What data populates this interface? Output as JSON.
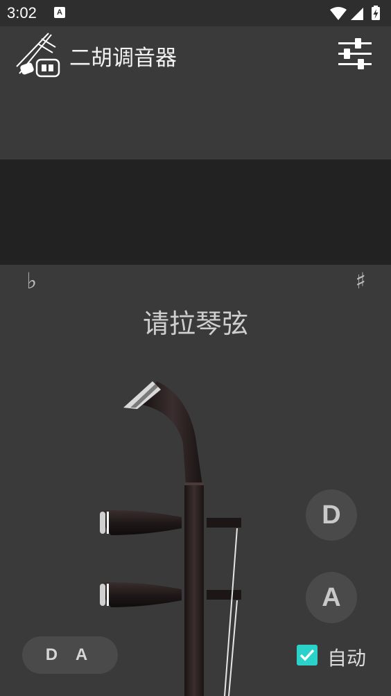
{
  "status_bar": {
    "time": "3:02",
    "notification_badge": "A"
  },
  "app_bar": {
    "title": "二胡调音器",
    "logo_icon": "erhu-logo-icon",
    "settings_icon": "sliders-icon"
  },
  "tuner": {
    "flat_symbol": "♭",
    "sharp_symbol": "♯",
    "prompt": "请拉琴弦"
  },
  "strings": {
    "inner": "D",
    "outer": "A"
  },
  "mode_button": "D A",
  "auto_checkbox": {
    "label": "自动",
    "checked": true
  },
  "colors": {
    "background": "#3a3a3a",
    "dark_band": "#222222",
    "checkbox_accent": "#2ad2c9",
    "button_bg": "#4a4a4a"
  }
}
